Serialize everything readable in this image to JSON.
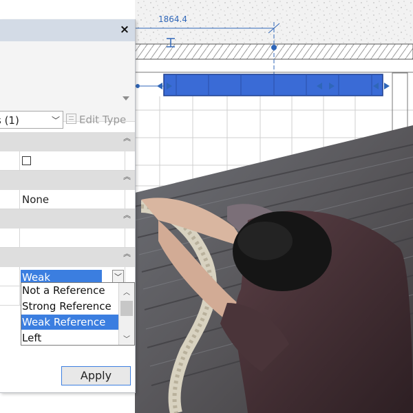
{
  "canvas": {
    "dimension_label": "1864.4"
  },
  "panel": {
    "close_symbol": "×",
    "type_filter": "s (1)",
    "edit_type_label": "Edit Type",
    "rows": {
      "checkbox_value": "",
      "row2_value": "None",
      "reference_value": "Weak Reference"
    },
    "dropdown_options": [
      "Not a Reference",
      "Strong Reference",
      "Weak Reference",
      "Left"
    ],
    "selected_option": "Weak Reference",
    "apply_label": "Apply"
  },
  "colors": {
    "selection": "#3b7ee0",
    "cad_line": "#2f66b8",
    "beam_fill": "#3a6bd6"
  }
}
